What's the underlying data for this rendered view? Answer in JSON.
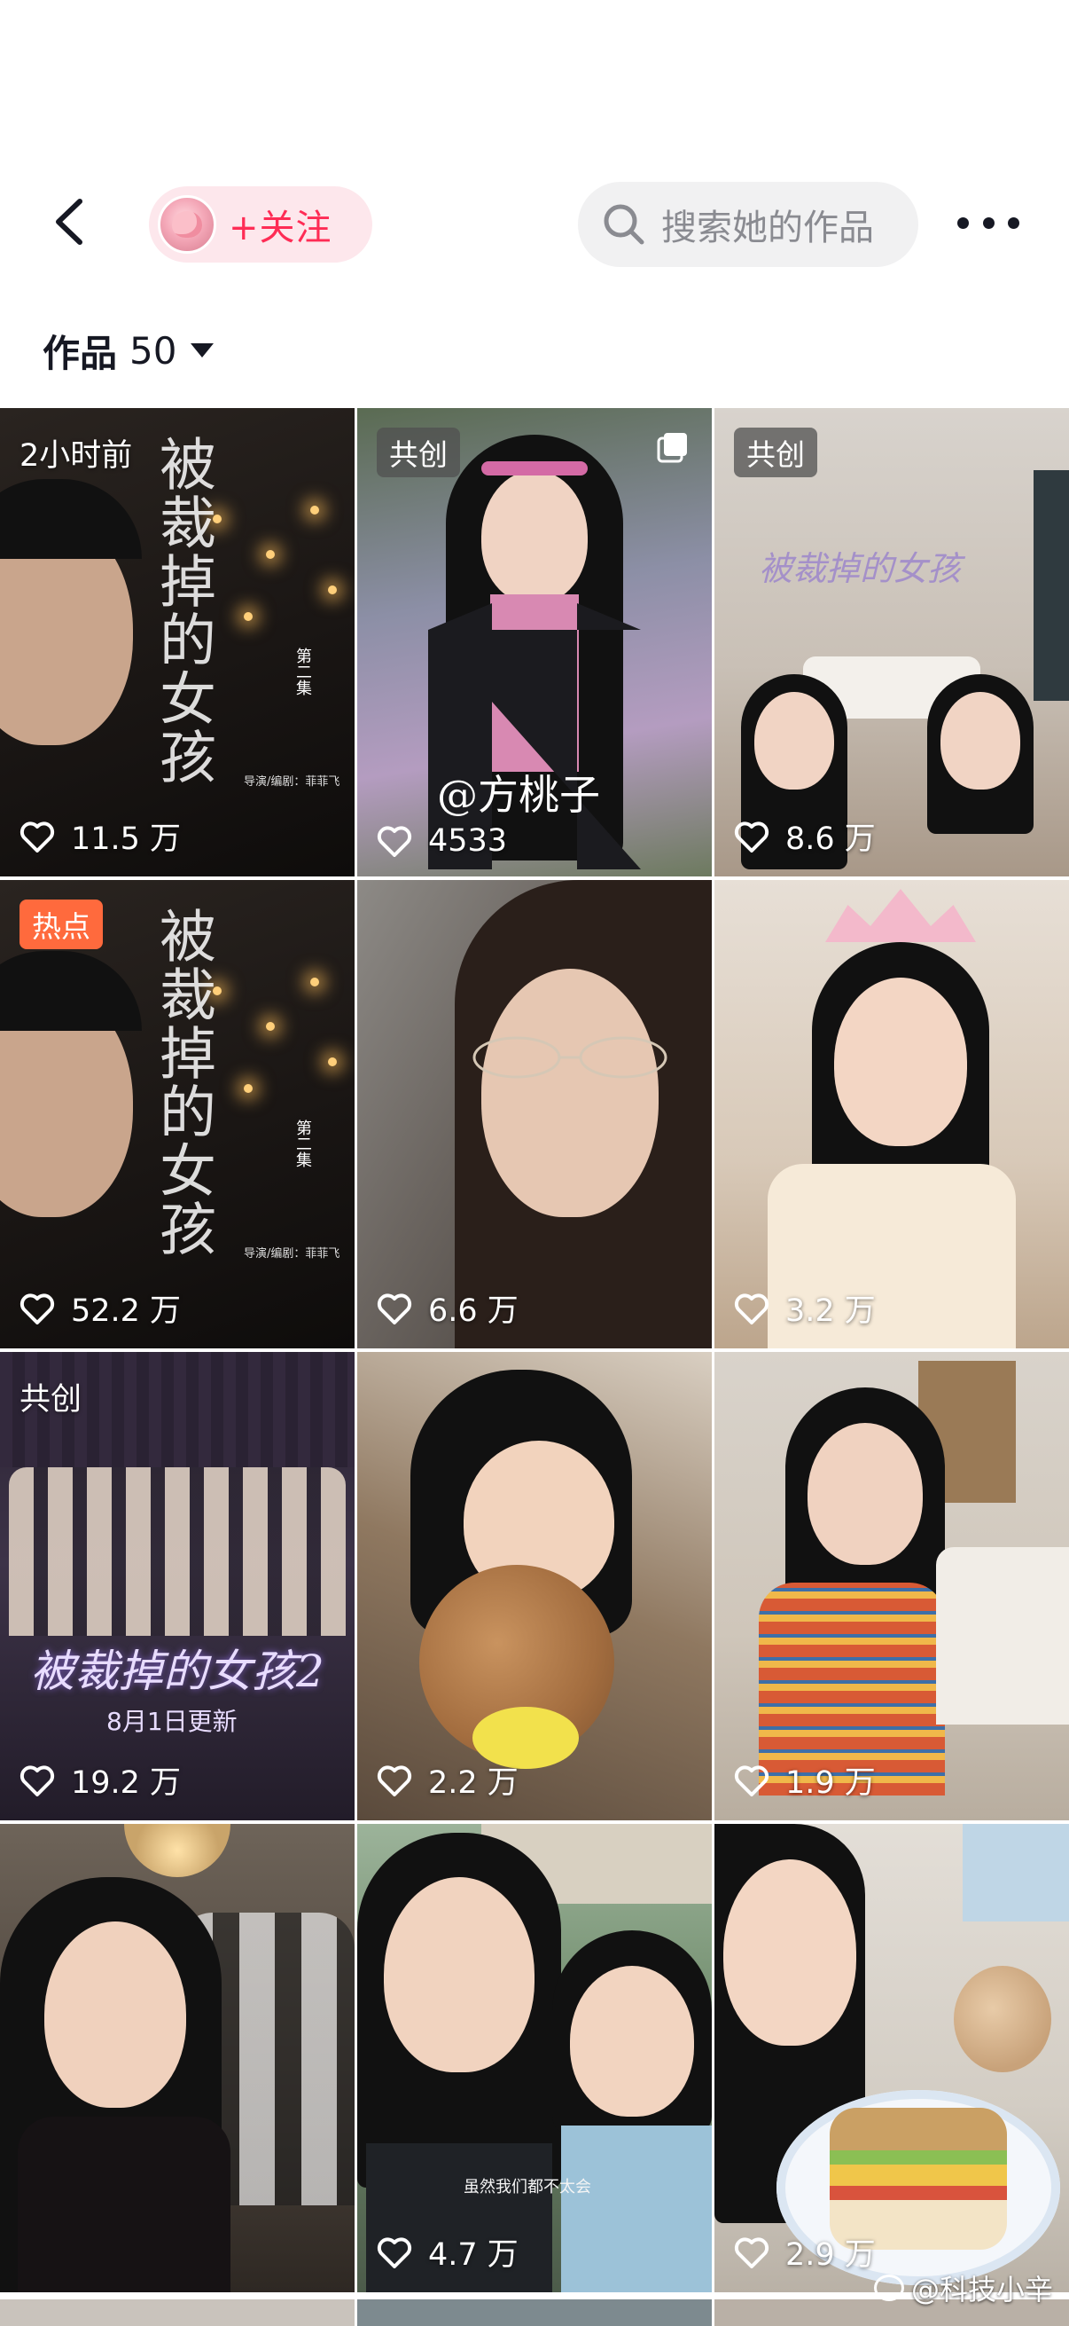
{
  "header": {
    "follow_label": "+关注",
    "search_placeholder": "搜索她的作品"
  },
  "works": {
    "label": "作品",
    "count": "50"
  },
  "tiles": [
    {
      "corner": "2小时前",
      "corner_style": "plain",
      "likes": "11.5 万",
      "poster_title": "被裁掉的女孩",
      "poster_sub": "第二集",
      "poster_credit": "导演/编剧：菲菲飞"
    },
    {
      "corner": "共创",
      "corner_style": "gray",
      "likes": "4533",
      "overlay_text": "@方桃子"
    },
    {
      "corner": "共创",
      "corner_style": "gray",
      "likes": "8.6 万",
      "overlay_text": "被裁掉的女孩"
    },
    {
      "corner": "热点",
      "corner_style": "hot",
      "likes": "52.2 万",
      "poster_title": "被裁掉的女孩",
      "poster_sub": "第二集",
      "poster_credit": "导演/编剧：菲菲飞"
    },
    {
      "corner": "",
      "corner_style": "none",
      "likes": "6.6 万"
    },
    {
      "corner": "",
      "corner_style": "none",
      "likes": "3.2 万"
    },
    {
      "corner": "共创",
      "corner_style": "plain",
      "likes": "19.2 万",
      "overlay_text": "被裁掉的女孩2",
      "overlay_sub": "8月1日更新"
    },
    {
      "corner": "",
      "corner_style": "none",
      "likes": "2.2 万"
    },
    {
      "corner": "",
      "corner_style": "none",
      "likes": "1.9 万"
    },
    {
      "corner": "",
      "corner_style": "none",
      "likes": ""
    },
    {
      "corner": "",
      "corner_style": "none",
      "likes": "4.7 万",
      "overlay_text": "虽然我们都不太会"
    },
    {
      "corner": "",
      "corner_style": "none",
      "likes": "2.9 万"
    }
  ],
  "watermark": "@科技小辛",
  "colors": {
    "accent": "#fe2c55",
    "hot_badge": "#ff6a3d"
  }
}
